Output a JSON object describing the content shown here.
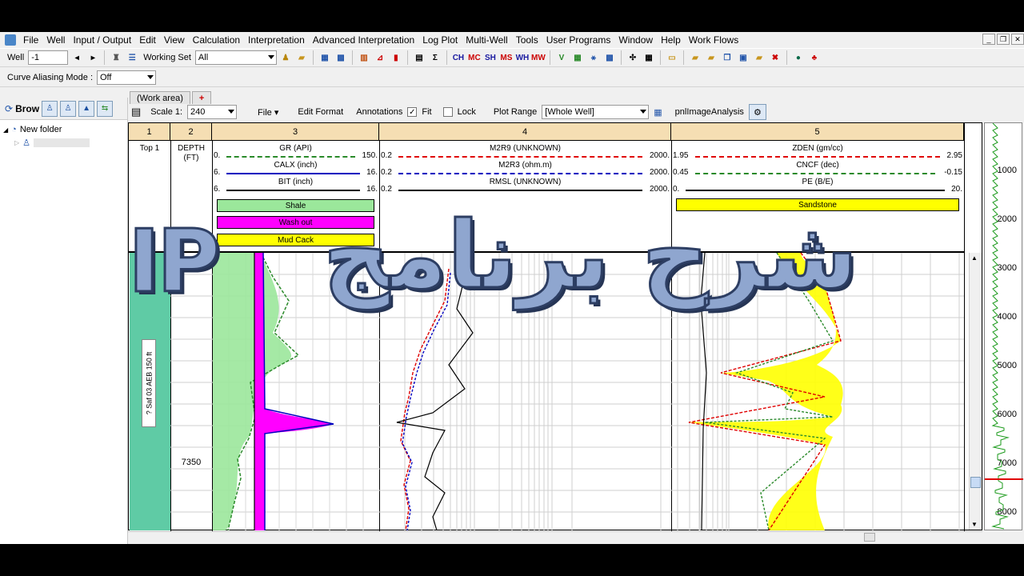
{
  "menu": [
    "File",
    "Well",
    "Input / Output",
    "Edit",
    "View",
    "Calculation",
    "Interpretation",
    "Advanced Interpretation",
    "Log Plot",
    "Multi-Well",
    "Tools",
    "User Programs",
    "Window",
    "Help",
    "Work Flows"
  ],
  "toolbar1": {
    "well_label": "Well",
    "well_value": "-1",
    "working_set_label": "Working Set",
    "working_set_value": "All",
    "buttons": [
      "CH",
      "MC",
      "SH",
      "MS",
      "WH",
      "MW"
    ]
  },
  "toolbar2": {
    "curve_aliasing_label": "Curve Aliasing Mode :",
    "curve_aliasing_value": "Off"
  },
  "browser": {
    "title": "Brow",
    "tree_root": "New folder"
  },
  "tabs": {
    "work_area": "(Work area)",
    "add": "+"
  },
  "plot_toolbar": {
    "scale_label": "Scale 1:",
    "scale_value": "240",
    "file_label": "File",
    "edit_format": "Edit Format",
    "annotations": "Annotations",
    "fit_label": "Fit",
    "lock_label": "Lock",
    "plot_range_label": "Plot Range",
    "plot_range_value": "[Whole Well]",
    "image_analysis": "pnlImageAnalysis"
  },
  "tracks": [
    {
      "number": "1",
      "header": "Top 1"
    },
    {
      "number": "2",
      "header": "DEPTH",
      "unit": "(FT)"
    },
    {
      "number": "3",
      "curves": [
        {
          "name": "GR (API)",
          "lo": "0.",
          "hi": "150.",
          "color": "#2a8a2a",
          "style": "dashed"
        },
        {
          "name": "CALX (inch)",
          "lo": "6.",
          "hi": "16.",
          "color": "#0000c0",
          "style": "solid"
        },
        {
          "name": "BIT (inch)",
          "lo": "6.",
          "hi": "16.",
          "color": "#000000",
          "style": "solid"
        }
      ],
      "fills": [
        {
          "label": "Shale",
          "color": "#8fe38f"
        },
        {
          "label": "Wash out",
          "color": "#ff00ff"
        },
        {
          "label": "Mud Cack",
          "color": "#ffff00"
        }
      ]
    },
    {
      "number": "4",
      "curves": [
        {
          "name": "M2R9 (UNKNOWN)",
          "lo": "0.2",
          "hi": "2000.",
          "color": "#e00000",
          "style": "dashed"
        },
        {
          "name": "M2R3 (ohm.m)",
          "lo": "0.2",
          "hi": "2000.",
          "color": "#0000c0",
          "style": "dashed"
        },
        {
          "name": "RMSL (UNKNOWN)",
          "lo": "0.2",
          "hi": "2000.",
          "color": "#000000",
          "style": "solid"
        }
      ]
    },
    {
      "number": "5",
      "curves": [
        {
          "name": "ZDEN (gm/cc)",
          "lo": "1.95",
          "hi": "2.95",
          "color": "#e00000",
          "style": "dashed"
        },
        {
          "name": "CNCF (dec)",
          "lo": "0.45",
          "hi": "-0.15",
          "color": "#2a8a2a",
          "style": "dashed"
        },
        {
          "name": "PE (B/E)",
          "lo": "0.",
          "hi": "20.",
          "color": "#000000",
          "style": "solid"
        }
      ],
      "fills": [
        {
          "label": "Sandstone",
          "color": "#ffff00"
        }
      ]
    }
  ],
  "zone_label": "? Saf 03 AEB 150 ft",
  "depth_label": "7350",
  "overview_depths": [
    "1000",
    "2000",
    "3000",
    "4000",
    "5000",
    "6000",
    "7000",
    "8000"
  ],
  "overlay": {
    "latin": "IP",
    "arabic": "شرح برنامج"
  }
}
